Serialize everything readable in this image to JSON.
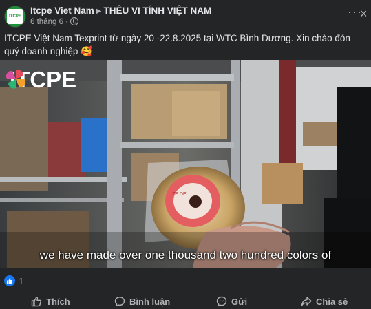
{
  "post": {
    "page_name": "Itcpe Viet Nam",
    "group_name": "THÊU VI TÍNH VIỆT NAM",
    "time": "6 tháng 6",
    "caption": "ITCPE Việt Nam Texprint từ ngày 20 -22.8.2025 tại WTC Bình Dương. Xin chào đón quý doanh nghiệp 🥰",
    "avatar_text": "ITCPE"
  },
  "video": {
    "logo_text": "ITCPE",
    "subtitle": "we have made over one thousand two hundred colors of",
    "label_text": "ZE DE"
  },
  "reactions": {
    "count": "1"
  },
  "actions": {
    "like": "Thích",
    "comment": "Bình luận",
    "send": "Gửi",
    "share": "Chia sẻ"
  },
  "colors": {
    "background": "#242526",
    "text_primary": "#e4e6eb",
    "text_secondary": "#b0b3b8",
    "like_blue": "#1877f2"
  }
}
